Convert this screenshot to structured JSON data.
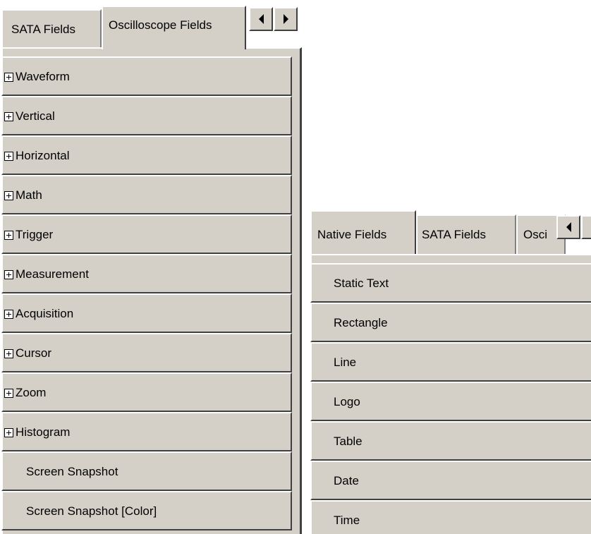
{
  "left_panel": {
    "tabs": [
      {
        "label": "SATA Fields",
        "active": false
      },
      {
        "label": "Oscilloscope Fields",
        "active": true
      }
    ],
    "scroll_left_icon": "arrow-left-icon",
    "scroll_right_icon": "arrow-right-icon",
    "items": [
      {
        "label": "Waveform",
        "expandable": true
      },
      {
        "label": "Vertical",
        "expandable": true
      },
      {
        "label": "Horizontal",
        "expandable": true
      },
      {
        "label": "Math",
        "expandable": true
      },
      {
        "label": "Trigger",
        "expandable": true
      },
      {
        "label": "Measurement",
        "expandable": true
      },
      {
        "label": "Acquisition",
        "expandable": true
      },
      {
        "label": "Cursor",
        "expandable": true
      },
      {
        "label": "Zoom",
        "expandable": true
      },
      {
        "label": "Histogram",
        "expandable": true
      },
      {
        "label": "Screen Snapshot",
        "expandable": false
      },
      {
        "label": "Screen Snapshot [Color]",
        "expandable": false
      }
    ]
  },
  "right_panel": {
    "tabs": [
      {
        "label": "Native Fields",
        "active": true
      },
      {
        "label": "SATA Fields",
        "active": false
      },
      {
        "label": "Osci",
        "active": false
      }
    ],
    "scroll_left_icon": "arrow-left-icon",
    "items": [
      {
        "label": "Static Text"
      },
      {
        "label": "Rectangle"
      },
      {
        "label": "Line"
      },
      {
        "label": "Logo"
      },
      {
        "label": "Table"
      },
      {
        "label": "Date"
      },
      {
        "label": "Time"
      }
    ]
  },
  "colors": {
    "face": "#d4d0c8",
    "highlight": "#ffffff",
    "shadow": "#404040",
    "background": "#ffffff"
  }
}
